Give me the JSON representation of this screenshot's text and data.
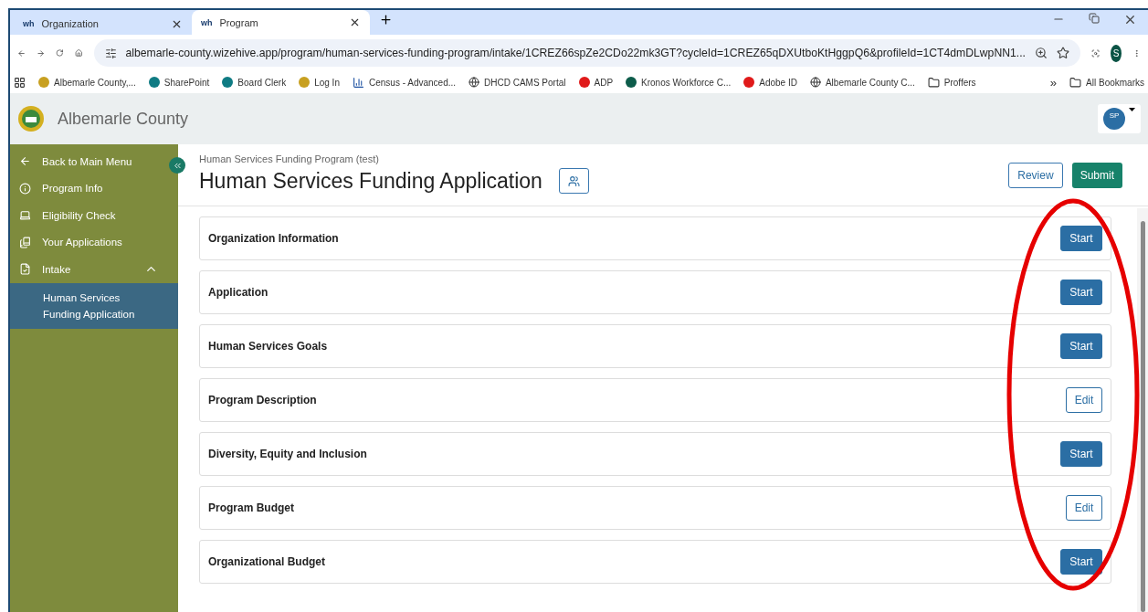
{
  "browser": {
    "tabs": [
      {
        "favicon": "wh",
        "title": "Organization",
        "selected": false
      },
      {
        "favicon": "wh",
        "title": "Program",
        "selected": true
      }
    ],
    "url": "albemarle-county.wizehive.app/program/human-services-funding-program/intake/1CREZ66spZe2CDo22mk3GT?cycleId=1CREZ65qDXUtboKtHggpQ6&profileId=1CT4dmDLwpNN1...",
    "profile_initial": "S",
    "bookmarks": [
      {
        "kind": "seal",
        "label": "Albemarle County,..."
      },
      {
        "kind": "sharepoint",
        "label": "SharePoint"
      },
      {
        "kind": "sharepoint",
        "label": "Board Clerk"
      },
      {
        "kind": "seal",
        "label": "Log In"
      },
      {
        "kind": "chart",
        "label": "Census - Advanced..."
      },
      {
        "kind": "globe",
        "label": "DHCD CAMS Portal"
      },
      {
        "kind": "adp",
        "label": "ADP"
      },
      {
        "kind": "kronos",
        "label": "Kronos Workforce C..."
      },
      {
        "kind": "adobe",
        "label": "Adobe ID"
      },
      {
        "kind": "globe",
        "label": "Albemarle County C..."
      },
      {
        "kind": "folder",
        "label": "Proffers"
      }
    ],
    "more_bookmarks": "»",
    "all_bookmarks": "All Bookmarks"
  },
  "app": {
    "title": "Albemarle County",
    "avatar": "SP"
  },
  "sidebar": {
    "items": [
      {
        "kind": "back",
        "label": "Back to Main Menu",
        "selected": false
      },
      {
        "kind": "info",
        "label": "Program Info",
        "selected": false
      },
      {
        "kind": "check",
        "label": "Eligibility Check",
        "selected": false
      },
      {
        "kind": "apps",
        "label": "Your Applications",
        "selected": false
      },
      {
        "kind": "intake",
        "label": "Intake",
        "selected": false,
        "expanded": true,
        "children": [
          {
            "label": "Human Services Funding Application",
            "selected": true
          }
        ]
      }
    ]
  },
  "page": {
    "breadcrumb": "Human Services Funding Program (test)",
    "title": "Human Services Funding Application",
    "review": "Review",
    "submit": "Submit",
    "sections": [
      {
        "label": "Organization Information",
        "action": "Start",
        "kind": "start"
      },
      {
        "label": "Application",
        "action": "Start",
        "kind": "start"
      },
      {
        "label": "Human Services Goals",
        "action": "Start",
        "kind": "start"
      },
      {
        "label": "Program Description",
        "action": "Edit",
        "kind": "edit"
      },
      {
        "label": "Diversity, Equity and Inclusion",
        "action": "Start",
        "kind": "start"
      },
      {
        "label": "Program Budget",
        "action": "Edit",
        "kind": "edit"
      },
      {
        "label": "Organizational Budget",
        "action": "Start",
        "kind": "start"
      }
    ]
  },
  "annotations": [
    {
      "kind": "ellipse",
      "color": "#e60000"
    }
  ]
}
